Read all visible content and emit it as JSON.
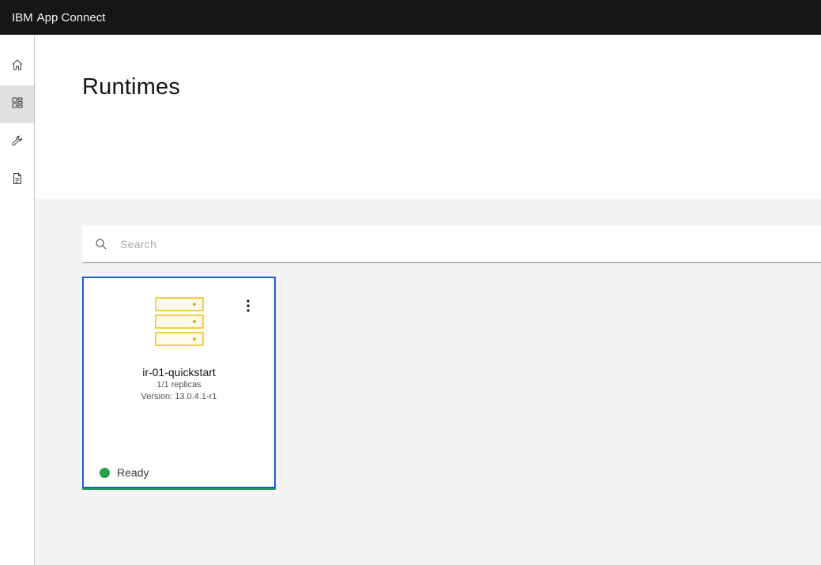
{
  "header": {
    "brand_strong": "IBM",
    "brand_name": "App Connect"
  },
  "sidenav": {
    "items": [
      {
        "icon": "home-icon",
        "active": false
      },
      {
        "icon": "dashboard-icon",
        "active": true
      },
      {
        "icon": "wrench-icon",
        "active": false
      },
      {
        "icon": "document-icon",
        "active": false
      }
    ]
  },
  "page": {
    "title": "Runtimes"
  },
  "search": {
    "placeholder": "Search",
    "value": ""
  },
  "runtimes": [
    {
      "name": "ir-01-quickstart",
      "replicas": "1/1 replicas",
      "version": "Version: 13.0.4.1-r1",
      "status": "Ready",
      "status_color": "#24a148",
      "icon": "server-icon"
    }
  ],
  "colors": {
    "header_bg": "#161616",
    "card_border": "#1a5fcf",
    "icon_yellow": "#f1c21b",
    "status_ready": "#24a148"
  }
}
